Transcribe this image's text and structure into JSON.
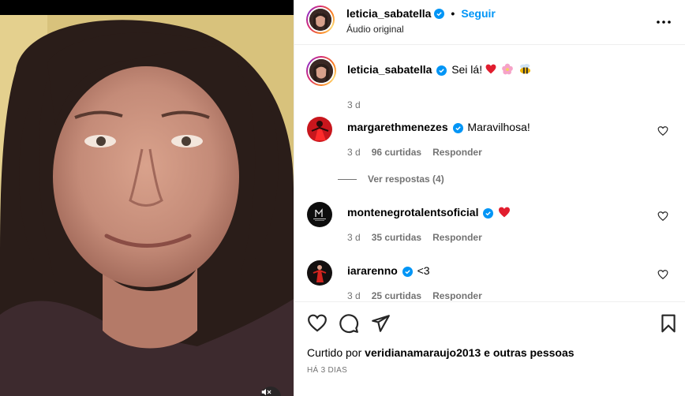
{
  "post": {
    "username": "leticia_sabatella",
    "follow_label": "Seguir",
    "audio_label": "Áudio original",
    "caption_text": "Sei lá!",
    "caption_emojis": [
      "heart",
      "flower",
      "bee"
    ],
    "caption_time": "3 d"
  },
  "comments": [
    {
      "username": "margarethmenezes",
      "text": "Maravilhosa!",
      "time": "3 d",
      "likes": "96 curtidas",
      "reply_label": "Responder",
      "replies_label": "Ver respostas (4)"
    },
    {
      "username": "montenegrotalentsoficial",
      "text": "",
      "emoji": "heart",
      "time": "3 d",
      "likes": "35 curtidas",
      "reply_label": "Responder"
    },
    {
      "username": "iararenno",
      "text": "<3",
      "time": "3 d",
      "likes": "25 curtidas",
      "reply_label": "Responder"
    }
  ],
  "footer": {
    "liked_prefix": "Curtido por",
    "liked_user": "veridianamaraujo2013",
    "liked_suffix": "e outras pessoas",
    "timestamp": "HÁ 3 DIAS"
  },
  "colors": {
    "accent": "#0095f6",
    "heart": "#ff3040",
    "muted_text": "#737373"
  }
}
